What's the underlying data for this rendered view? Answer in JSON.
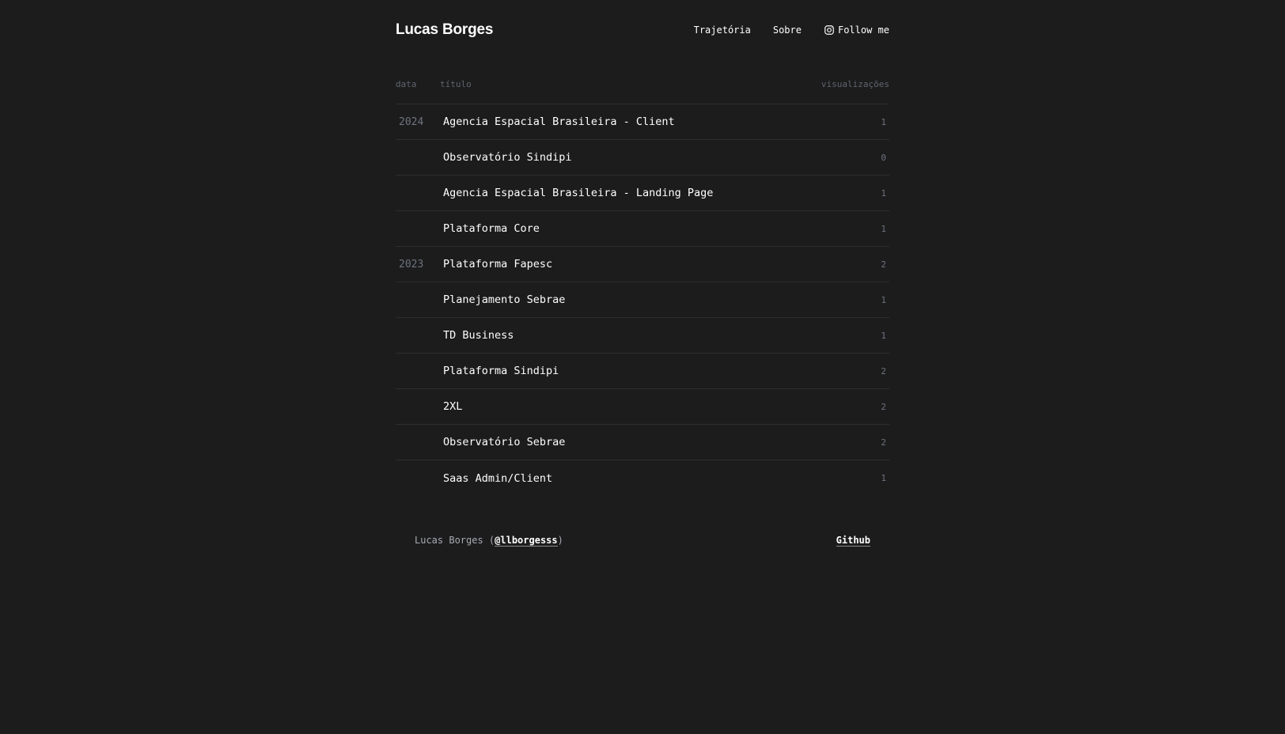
{
  "header": {
    "site_title": "Lucas Borges",
    "nav": {
      "trajetoria": "Trajetória",
      "sobre": "Sobre",
      "follow": "Follow me"
    }
  },
  "table": {
    "columns": {
      "date": "data",
      "title": "título",
      "views": "visualizações"
    },
    "rows": [
      {
        "year": "2024",
        "title": "Agencia Espacial Brasileira - Client",
        "views": "1"
      },
      {
        "year": "",
        "title": "Observatório Sindipi",
        "views": "0"
      },
      {
        "year": "",
        "title": "Agencia Espacial Brasileira - Landing Page",
        "views": "1"
      },
      {
        "year": "",
        "title": "Plataforma Core",
        "views": "1"
      },
      {
        "year": "2023",
        "title": "Plataforma Fapesc",
        "views": "2"
      },
      {
        "year": "",
        "title": "Planejamento Sebrae",
        "views": "1"
      },
      {
        "year": "",
        "title": "TD Business",
        "views": "1"
      },
      {
        "year": "",
        "title": "Plataforma Sindipi",
        "views": "2"
      },
      {
        "year": "",
        "title": "2XL",
        "views": "2"
      },
      {
        "year": "",
        "title": "Observatório Sebrae",
        "views": "2"
      },
      {
        "year": "",
        "title": "Saas Admin/Client",
        "views": "1"
      }
    ]
  },
  "footer": {
    "name": "Lucas Borges",
    "handle": "@llborgesss",
    "github": "Github"
  },
  "colors": {
    "background": "#1c1c1c",
    "text": "#ffffff",
    "muted": "#6e7380",
    "divider": "#2e2e2e"
  },
  "icons": {
    "follow": "instagram-icon"
  }
}
